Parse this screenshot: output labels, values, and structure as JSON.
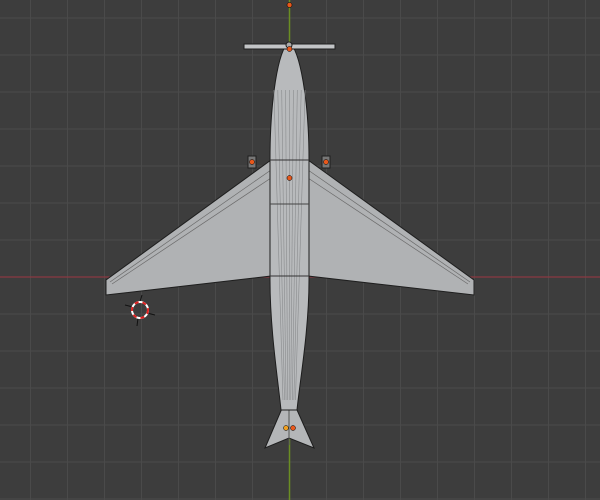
{
  "viewport": {
    "view": "top-orthographic",
    "object": "airplane"
  },
  "colors": {
    "background": "#3d3d3d",
    "grid": "#4a4a4a",
    "x_axis": "#8a3a42",
    "y_axis": "#6b8e23",
    "mesh": "#b4b6b8",
    "wire": "#2a2a2a",
    "origin": "#e8581c"
  }
}
